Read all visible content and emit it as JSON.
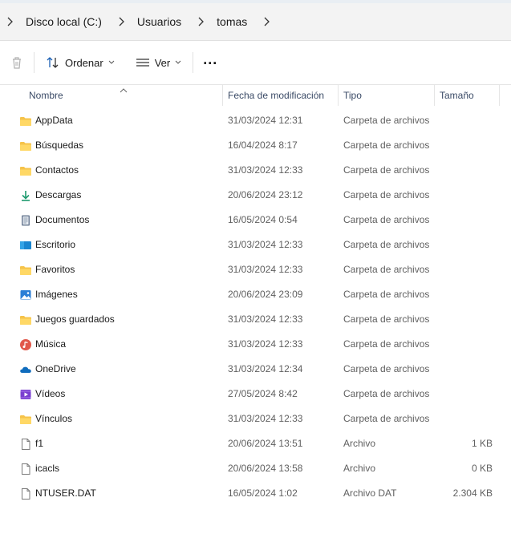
{
  "breadcrumb": {
    "items": [
      "Disco local (C:)",
      "Usuarios",
      "tomas"
    ]
  },
  "toolbar": {
    "sort_label": "Ordenar",
    "view_label": "Ver",
    "more_label": "..."
  },
  "columns": {
    "name": "Nombre",
    "date": "Fecha de modificación",
    "type": "Tipo",
    "size": "Tamaño"
  },
  "files": [
    {
      "name": "AppData",
      "date": "31/03/2024 12:31",
      "type": "Carpeta de archivos",
      "size": "",
      "icon": "folder-icon"
    },
    {
      "name": "Búsquedas",
      "date": "16/04/2024 8:17",
      "type": "Carpeta de archivos",
      "size": "",
      "icon": "folder-icon"
    },
    {
      "name": "Contactos",
      "date": "31/03/2024 12:33",
      "type": "Carpeta de archivos",
      "size": "",
      "icon": "folder-icon"
    },
    {
      "name": "Descargas",
      "date": "20/06/2024 23:12",
      "type": "Carpeta de archivos",
      "size": "",
      "icon": "download-icon"
    },
    {
      "name": "Documentos",
      "date": "16/05/2024 0:54",
      "type": "Carpeta de archivos",
      "size": "",
      "icon": "documents-icon"
    },
    {
      "name": "Escritorio",
      "date": "31/03/2024 12:33",
      "type": "Carpeta de archivos",
      "size": "",
      "icon": "desktop-icon"
    },
    {
      "name": "Favoritos",
      "date": "31/03/2024 12:33",
      "type": "Carpeta de archivos",
      "size": "",
      "icon": "folder-icon"
    },
    {
      "name": "Imágenes",
      "date": "20/06/2024 23:09",
      "type": "Carpeta de archivos",
      "size": "",
      "icon": "pictures-icon"
    },
    {
      "name": "Juegos guardados",
      "date": "31/03/2024 12:33",
      "type": "Carpeta de archivos",
      "size": "",
      "icon": "folder-icon"
    },
    {
      "name": "Música",
      "date": "31/03/2024 12:33",
      "type": "Carpeta de archivos",
      "size": "",
      "icon": "music-icon"
    },
    {
      "name": "OneDrive",
      "date": "31/03/2024 12:34",
      "type": "Carpeta de archivos",
      "size": "",
      "icon": "onedrive-icon"
    },
    {
      "name": "Vídeos",
      "date": "27/05/2024 8:42",
      "type": "Carpeta de archivos",
      "size": "",
      "icon": "videos-icon"
    },
    {
      "name": "Vínculos",
      "date": "31/03/2024 12:33",
      "type": "Carpeta de archivos",
      "size": "",
      "icon": "folder-icon"
    },
    {
      "name": "f1",
      "date": "20/06/2024 13:51",
      "type": "Archivo",
      "size": "1 KB",
      "icon": "file-icon"
    },
    {
      "name": "icacls",
      "date": "20/06/2024 13:58",
      "type": "Archivo",
      "size": "0 KB",
      "icon": "file-icon"
    },
    {
      "name": "NTUSER.DAT",
      "date": "16/05/2024 1:02",
      "type": "Archivo DAT",
      "size": "2.304 KB",
      "icon": "file-icon"
    }
  ]
}
